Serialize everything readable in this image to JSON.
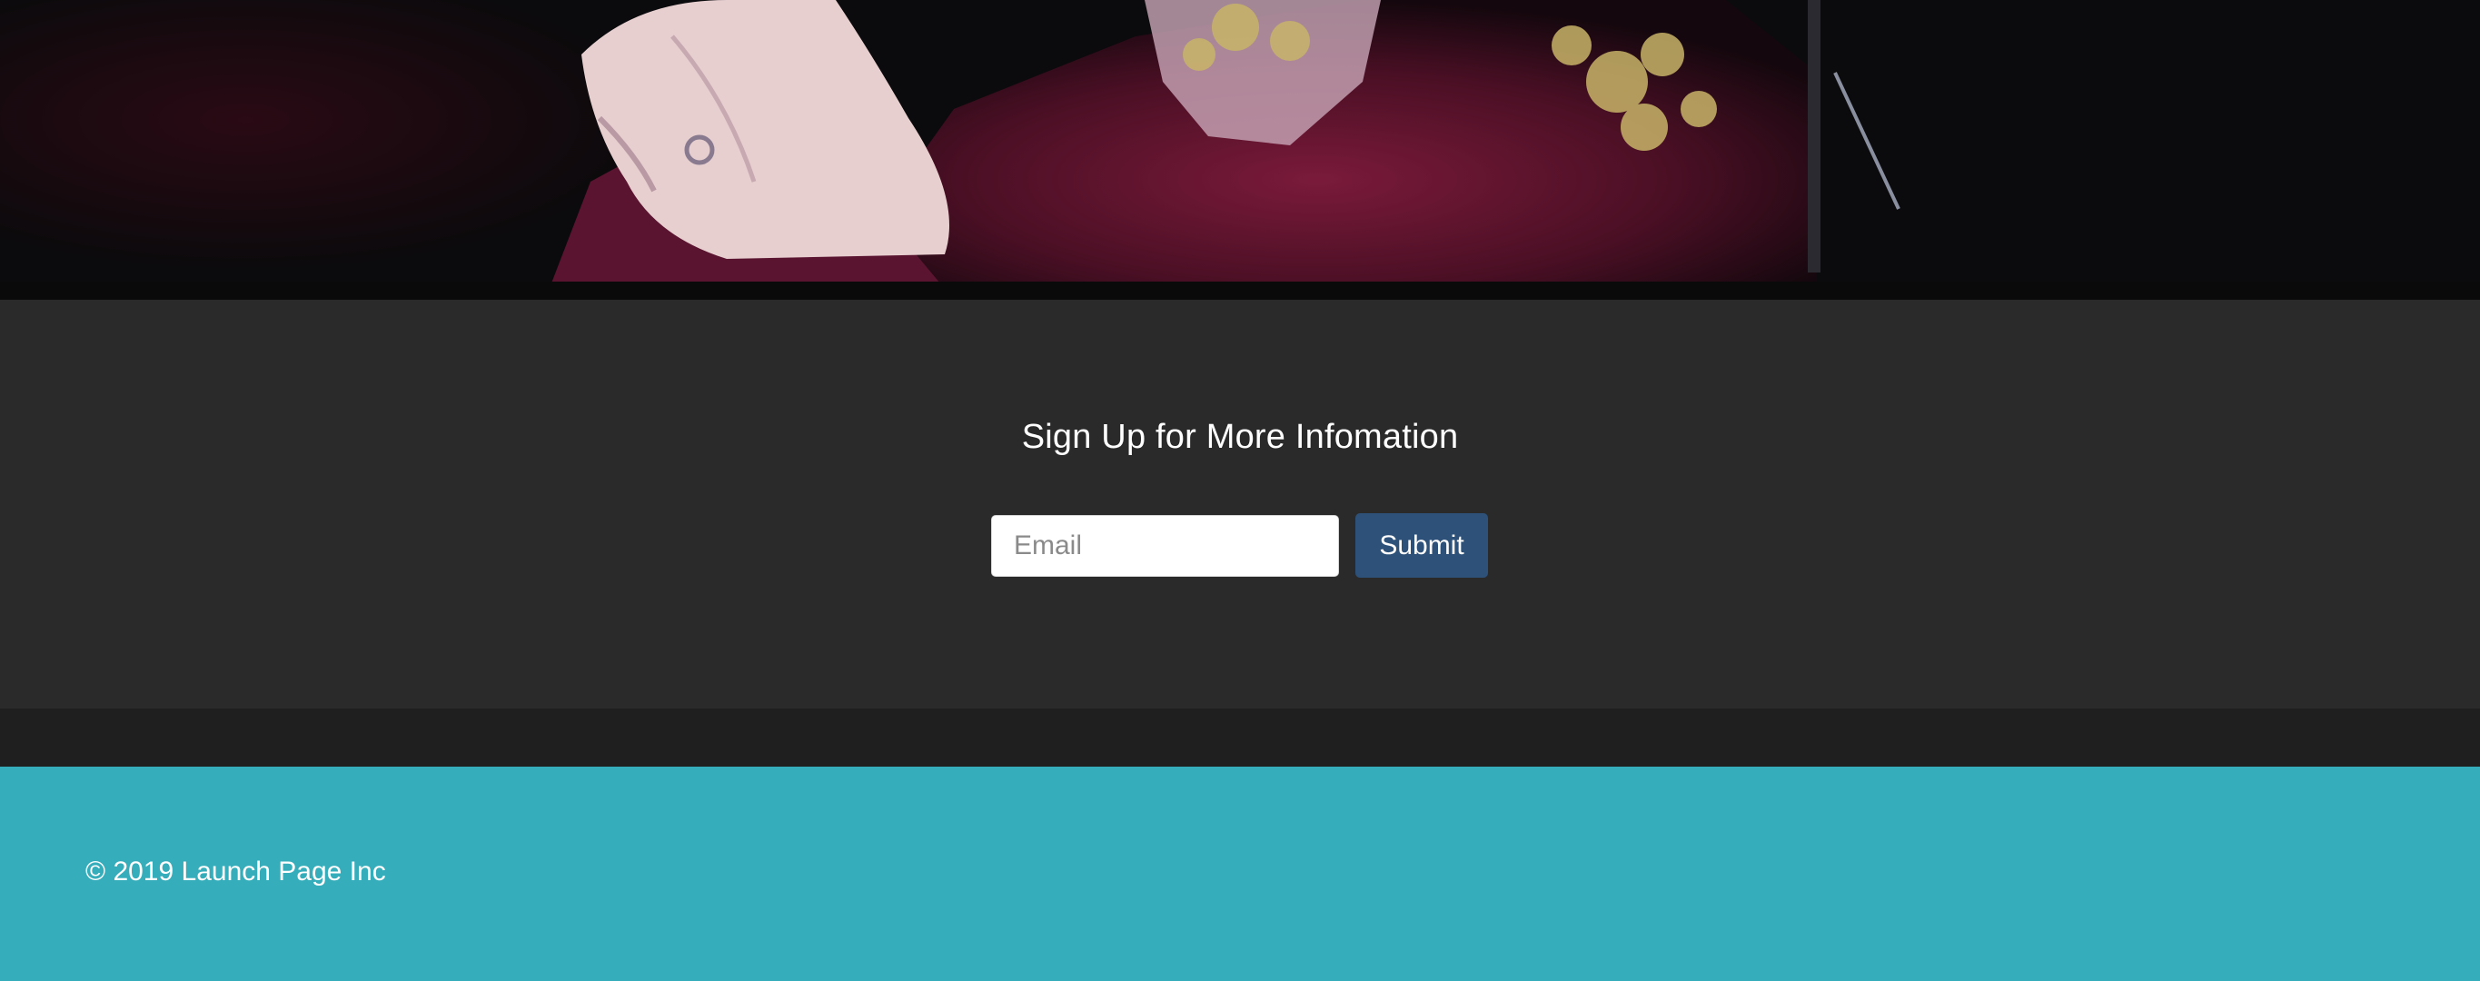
{
  "hero": {
    "image_icon": "photo-still-icon"
  },
  "signup": {
    "title": "Sign Up for More Infomation",
    "email_placeholder": "Email",
    "email_value": "",
    "submit_label": "Submit"
  },
  "footer": {
    "copyright": "© 2019 Launch Page Inc"
  },
  "colors": {
    "signup_bg": "#2a2a2a",
    "submit_bg": "#2d5178",
    "footer_bg": "#35adba",
    "page_bg": "#1e1e1e"
  }
}
